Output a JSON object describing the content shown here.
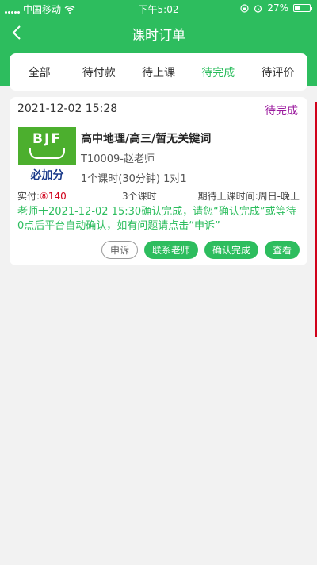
{
  "status_bar": {
    "carrier": "中国移动",
    "time": "下午5:02",
    "battery": "27%"
  },
  "nav": {
    "title": "课时订单"
  },
  "tabs": [
    {
      "label": "全部"
    },
    {
      "label": "待付款"
    },
    {
      "label": "待上课"
    },
    {
      "label": "待完成"
    },
    {
      "label": "待评价"
    }
  ],
  "active_tab": "待完成",
  "order": {
    "datetime": "2021-12-02 15:28",
    "status": "待完成",
    "thumb_logo": "BJF",
    "thumb_text": "必加分",
    "course_title": "高中地理/高三/暂无关键词",
    "teacher": "T10009-赵老师",
    "lessons": "1个课时(30分钟) 1对1",
    "paid_label": "实付:",
    "paid_amount": "⑧140",
    "lesson_count": "3个课时",
    "expect_time": "期待上课时间:周日-晚上",
    "notice": "老师于2021-12-02 15:30确认完成，请您“确认完成”或等待0点后平台自动确认，如有问题请点击“申诉”",
    "buttons": {
      "appeal": "申诉",
      "contact": "联系老师",
      "confirm": "确认完成",
      "view": "查看"
    }
  },
  "colors": {
    "primary": "#2dbd5e",
    "status": "#9b1a9e",
    "price": "#d0021b"
  }
}
